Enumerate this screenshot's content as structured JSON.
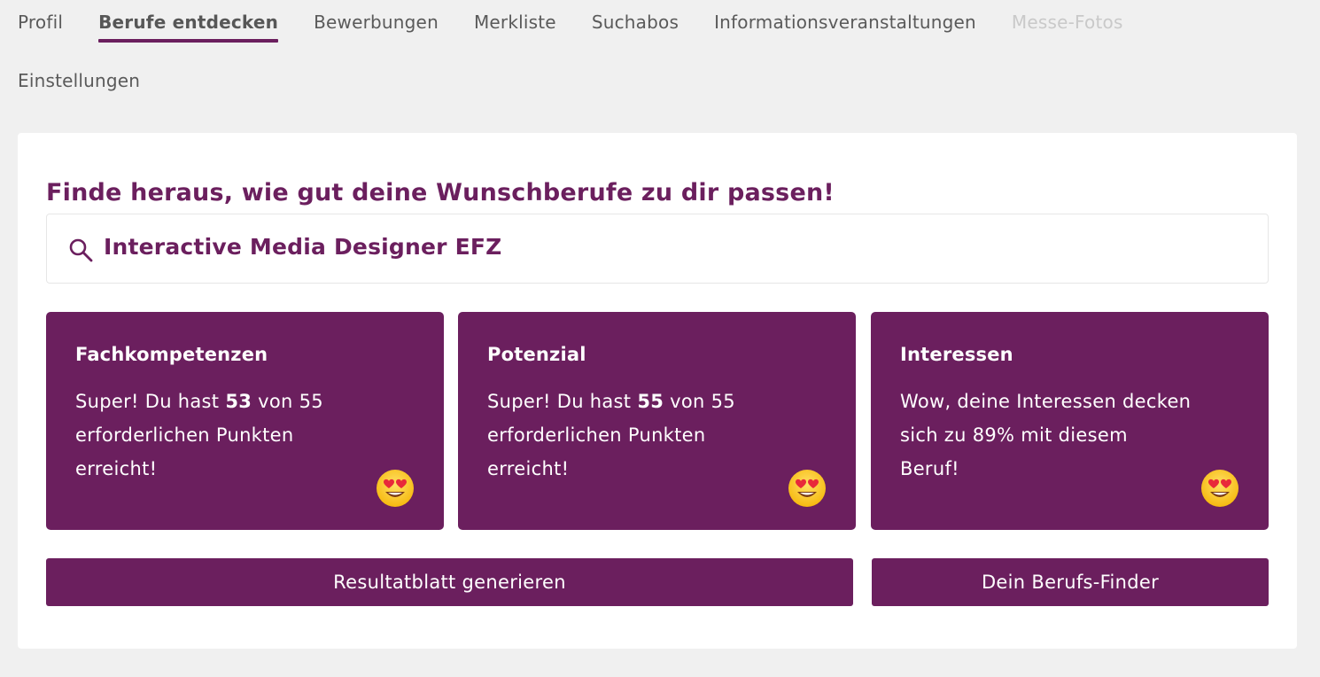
{
  "nav": {
    "tabs": [
      {
        "label": "Profil"
      },
      {
        "label": "Berufe entdecken"
      },
      {
        "label": "Bewerbungen"
      },
      {
        "label": "Merkliste"
      },
      {
        "label": "Suchabos"
      },
      {
        "label": "Informationsveranstaltungen"
      },
      {
        "label": "Messe-Fotos"
      },
      {
        "label": "Einstellungen"
      }
    ],
    "active_tab": "Berufe entdecken",
    "disabled_tab": "Messe-Fotos"
  },
  "main": {
    "headline": "Finde heraus, wie gut deine Wunschberufe zu dir passen!",
    "search": {
      "value": "Interactive Media Designer EFZ",
      "icon": "search-icon"
    },
    "tiles": [
      {
        "title": "Fachkompetenzen",
        "text_before": "Super! Du hast ",
        "score": "53",
        "text_after": " von 55 erforderlichen Punkten erreicht!",
        "icon": "heart-eyes-emoji-icon"
      },
      {
        "title": "Potenzial",
        "text_before": "Super! Du hast ",
        "score": "55",
        "text_after": " von 55 erforderlichen Punkten erreicht!",
        "icon": "heart-eyes-emoji-icon"
      },
      {
        "title": "Interessen",
        "text": "Wow, deine Interessen decken sich zu 89% mit diesem Beruf!",
        "icon": "heart-eyes-emoji-icon"
      }
    ],
    "buttons": {
      "generate_label": "Resultatblatt generieren",
      "finder_label": "Dein Berufs-Finder"
    }
  },
  "colors": {
    "accent": "#6b1f5e",
    "background": "#f0f0f0",
    "card": "#ffffff",
    "tab_text": "#5a5a5a",
    "tab_disabled": "#c9c9c9"
  }
}
